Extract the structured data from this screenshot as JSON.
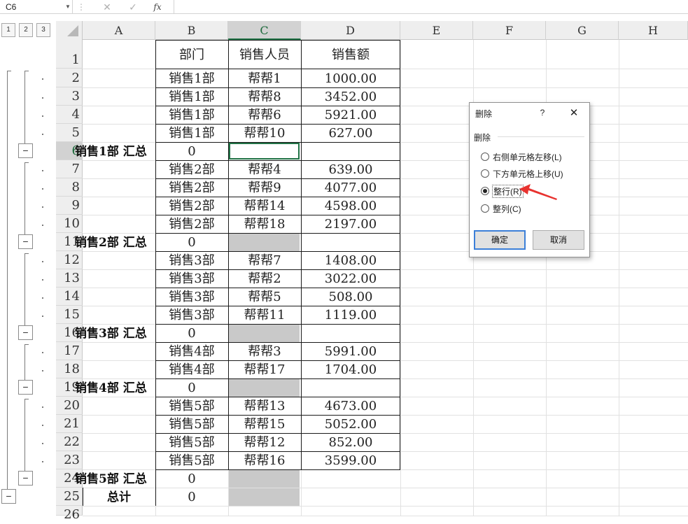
{
  "formula_bar": {
    "name_box": "C6",
    "cancel_glyph": "✕",
    "enter_glyph": "✓",
    "fx_glyph": "fx",
    "formula": ""
  },
  "outline_levels": [
    "1",
    "2",
    "3"
  ],
  "columns": [
    "A",
    "B",
    "C",
    "D",
    "E",
    "F",
    "G",
    "H"
  ],
  "selected_column": "C",
  "selected_row": "6",
  "rows": [
    {
      "n": "1",
      "a": "",
      "b": "部门",
      "c": "销售人员",
      "d": "销售额"
    },
    {
      "n": "2",
      "a": "",
      "b": "销售1部",
      "c": "帮帮1",
      "d": "1000.00"
    },
    {
      "n": "3",
      "a": "",
      "b": "销售1部",
      "c": "帮帮8",
      "d": "3452.00"
    },
    {
      "n": "4",
      "a": "",
      "b": "销售1部",
      "c": "帮帮6",
      "d": "5921.00"
    },
    {
      "n": "5",
      "a": "",
      "b": "销售1部",
      "c": "帮帮10",
      "d": "627.00"
    },
    {
      "n": "6",
      "a": "销售1部 汇总",
      "b": "0",
      "c": "",
      "d": ""
    },
    {
      "n": "7",
      "a": "",
      "b": "销售2部",
      "c": "帮帮4",
      "d": "639.00"
    },
    {
      "n": "8",
      "a": "",
      "b": "销售2部",
      "c": "帮帮9",
      "d": "4077.00"
    },
    {
      "n": "9",
      "a": "",
      "b": "销售2部",
      "c": "帮帮14",
      "d": "4598.00"
    },
    {
      "n": "10",
      "a": "",
      "b": "销售2部",
      "c": "帮帮18",
      "d": "2197.00"
    },
    {
      "n": "11",
      "a": "销售2部 汇总",
      "b": "0",
      "c": "",
      "d": ""
    },
    {
      "n": "12",
      "a": "",
      "b": "销售3部",
      "c": "帮帮7",
      "d": "1408.00"
    },
    {
      "n": "13",
      "a": "",
      "b": "销售3部",
      "c": "帮帮2",
      "d": "3022.00"
    },
    {
      "n": "14",
      "a": "",
      "b": "销售3部",
      "c": "帮帮5",
      "d": "508.00"
    },
    {
      "n": "15",
      "a": "",
      "b": "销售3部",
      "c": "帮帮11",
      "d": "1119.00"
    },
    {
      "n": "16",
      "a": "销售3部 汇总",
      "b": "0",
      "c": "",
      "d": ""
    },
    {
      "n": "17",
      "a": "",
      "b": "销售4部",
      "c": "帮帮3",
      "d": "5991.00"
    },
    {
      "n": "18",
      "a": "",
      "b": "销售4部",
      "c": "帮帮17",
      "d": "1704.00"
    },
    {
      "n": "19",
      "a": "销售4部 汇总",
      "b": "0",
      "c": "",
      "d": ""
    },
    {
      "n": "20",
      "a": "",
      "b": "销售5部",
      "c": "帮帮13",
      "d": "4673.00"
    },
    {
      "n": "21",
      "a": "",
      "b": "销售5部",
      "c": "帮帮15",
      "d": "5052.00"
    },
    {
      "n": "22",
      "a": "",
      "b": "销售5部",
      "c": "帮帮12",
      "d": "852.00"
    },
    {
      "n": "23",
      "a": "",
      "b": "销售5部",
      "c": "帮帮16",
      "d": "3599.00"
    },
    {
      "n": "24",
      "a": "销售5部 汇总",
      "b": "0",
      "c": "",
      "d": ""
    },
    {
      "n": "25",
      "a": "总计",
      "b": "0",
      "c": "",
      "d": ""
    },
    {
      "n": "26",
      "a": "",
      "b": "",
      "c": "",
      "d": ""
    }
  ],
  "subtotal_rows": [
    "6",
    "11",
    "16",
    "19",
    "24"
  ],
  "gray_c_rows": [
    "11",
    "16",
    "19",
    "24",
    "25"
  ],
  "dialog": {
    "title": "删除",
    "help": "?",
    "close": "✕",
    "group_label": "删除",
    "options": [
      {
        "label": "右侧单元格左移(L)",
        "selected": false
      },
      {
        "label": "下方单元格上移(U)",
        "selected": false
      },
      {
        "label": "整行(R)",
        "selected": true
      },
      {
        "label": "整列(C)",
        "selected": false
      }
    ],
    "ok": "确定",
    "cancel": "取消"
  },
  "colors": {
    "selection_green": "#217346",
    "header_bg": "#eeeeee",
    "subtotal_fill": "#c9c9c9",
    "arrow_red": "#e8322f",
    "dialog_default_border": "#3c7fd8"
  }
}
